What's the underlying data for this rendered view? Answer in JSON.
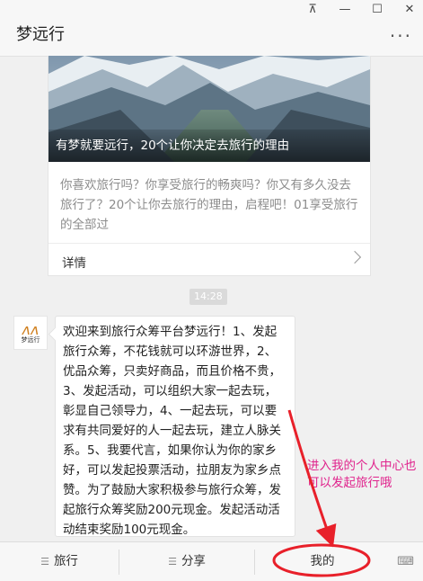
{
  "window": {
    "controls": [
      "pin-icon",
      "minimize-icon",
      "maximize-icon",
      "close-icon"
    ],
    "control_glyphs": [
      "⊼",
      "—",
      "☐",
      "✕"
    ]
  },
  "header": {
    "title": "梦远行",
    "more_icon": "more-dots-icon",
    "more_glyph": "···"
  },
  "article_card": {
    "caption": "有梦就要远行，20个让你决定去旅行的理由",
    "description": "你喜欢旅行吗？你享受旅行的畅爽吗？你又有多久没去旅行了？20个让你去旅行的理由，启程吧！01享受旅行的全部过",
    "detail_label": "详情"
  },
  "timestamp": "14:28",
  "message": {
    "avatar_logo": "ʌʌ",
    "avatar_text": "梦远行",
    "text": "欢迎来到旅行众筹平台梦远行！1、发起旅行众筹，不花钱就可以环游世界，2、优品众筹，只卖好商品，而且价格不贵，3、发起活动，可以组织大家一起去玩，彰显自己领导力，4、一起去玩，可以要求有共同爱好的人一起去玩，建立人脉关系。5、我要代言，如果你认为你的家乡好，可以发起投票活动，拉朋友为家乡点赞。为了鼓励大家积极参与旅行众筹，发起旅行众筹奖励200元现金。发起活动活动结束奖励100元现金。"
  },
  "annotation": {
    "text": "进入我的个人中心也可以发起旅行哦",
    "color": "#e0248d"
  },
  "bottom_menu": {
    "items": [
      {
        "label": "旅行",
        "icon": "menu-list-icon"
      },
      {
        "label": "分享",
        "icon": "menu-list-icon"
      },
      {
        "label": "我的",
        "icon": ""
      }
    ],
    "menu_glyph": "☰",
    "keyboard_icon": "keyboard-toggle-icon",
    "keyboard_glyph": "⌨"
  }
}
